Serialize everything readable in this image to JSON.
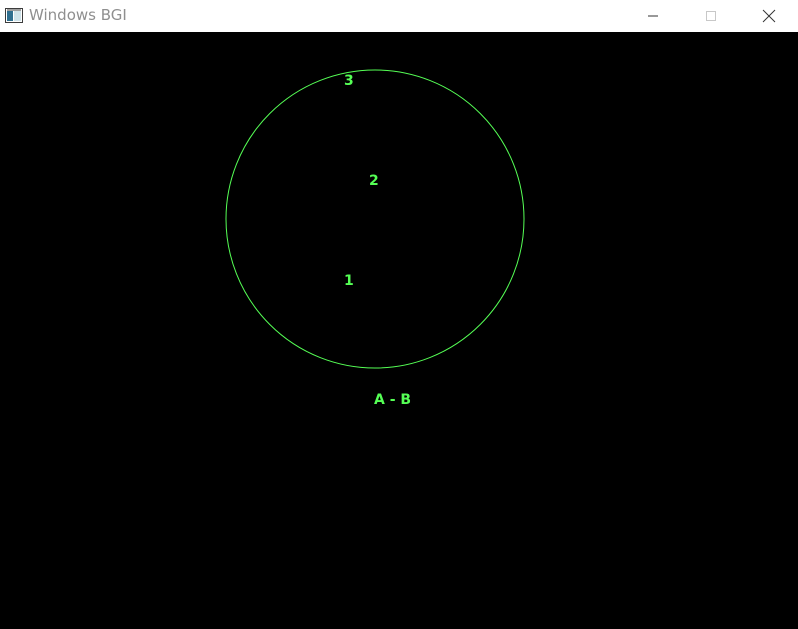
{
  "window": {
    "title": "Windows BGI",
    "icon": "bgi-app-icon",
    "controls": {
      "minimize_icon": "minimize-icon",
      "maximize_icon": "maximize-icon",
      "close_icon": "close-icon"
    }
  },
  "canvas": {
    "background": "#000000",
    "draw_color": "#55ff55",
    "labels": {
      "label_3": "3",
      "label_2": "2",
      "label_1": "1",
      "caption": "A - B"
    }
  }
}
